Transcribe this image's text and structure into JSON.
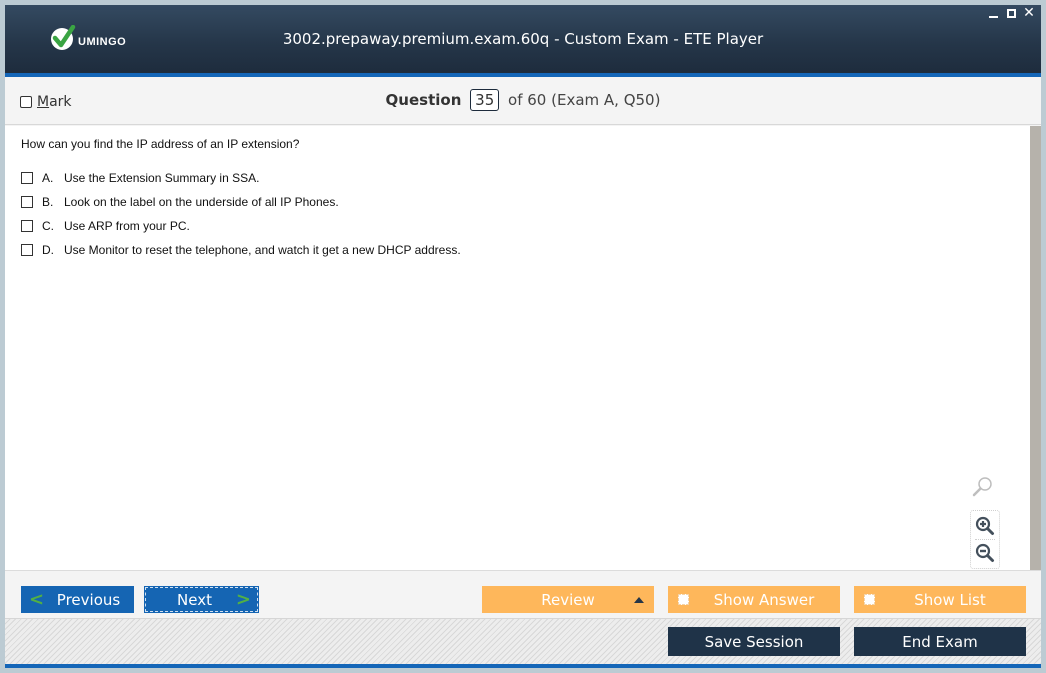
{
  "app": {
    "logo_text": "UMINGO",
    "title": "3002.prepaway.premium.exam.60q - Custom Exam - ETE Player",
    "window_controls": [
      "minimize-icon",
      "maximize-icon",
      "close-icon"
    ]
  },
  "header": {
    "mark_label_first": "M",
    "mark_label_rest": "ark",
    "mark_checked": false,
    "question_word": "Question",
    "question_number": "35",
    "question_suffix": "of 60 (Exam A, Q50)"
  },
  "question": {
    "text": "How can you find the IP address of an IP extension?",
    "options": [
      {
        "letter": "A.",
        "text": "Use the Extension Summary in SSA.",
        "checked": false
      },
      {
        "letter": "B.",
        "text": "Look on the label on the underside of all IP Phones.",
        "checked": false
      },
      {
        "letter": "C.",
        "text": "Use ARP from your PC.",
        "checked": false
      },
      {
        "letter": "D.",
        "text": "Use Monitor to reset the telephone, and watch it get a new DHCP address.",
        "checked": false
      }
    ]
  },
  "zoom_tools": [
    "search-icon",
    "zoom-in-icon",
    "zoom-out-icon"
  ],
  "nav": {
    "previous": "Previous",
    "next": "Next",
    "review": "Review",
    "show_answer": "Show Answer",
    "show_list": "Show List"
  },
  "footer": {
    "save_session": "Save Session",
    "end_exam": "End Exam"
  },
  "colors": {
    "titlebar": "#253649",
    "accent_blue": "#1466b8",
    "nav_blue": "#1565b3",
    "orange": "#feb75b",
    "dark_button": "#1f3348",
    "chevron_green": "#52b044"
  }
}
